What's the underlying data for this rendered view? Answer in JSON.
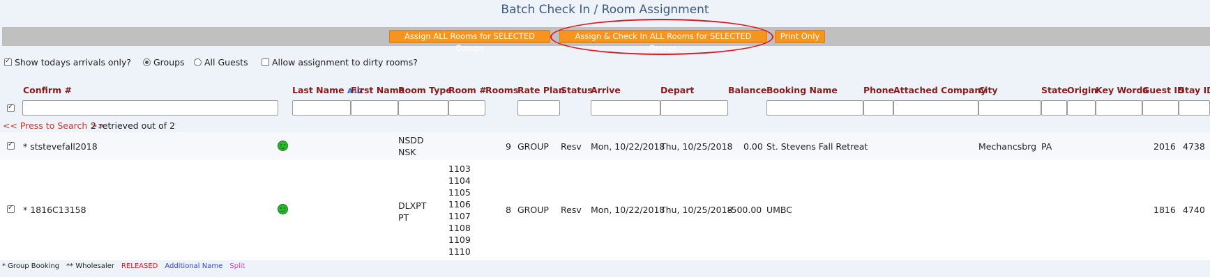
{
  "title": "Batch Check In / Room Assignment",
  "toolbar": {
    "assign_all": "Assign ALL Rooms for SELECTED Groups",
    "assign_checkin": "Assign & Check In ALL Rooms for SELECTED Groups",
    "print_only": "Print Only"
  },
  "options": {
    "todays_arrivals": "Show todays arrivals only?",
    "groups": "Groups",
    "all_guests": "All Guests",
    "dirty_rooms": "Allow assignment to dirty rooms?"
  },
  "columns": {
    "confirm": "Confirm #",
    "last_name": "Last Name",
    "first_name": "First Name",
    "room_type": "Room Type",
    "room_no": "Room #",
    "rooms": "Rooms",
    "rate_plan": "Rate Plan",
    "status": "Status",
    "arrive": "Arrive",
    "depart": "Depart",
    "balance": "Balance",
    "booking_name": "Booking Name",
    "phone": "Phone",
    "attached_company": "Attached Company",
    "city": "City",
    "state": "State",
    "origin": "Origin",
    "key_words": "Key Words",
    "guest_id": "Guest ID",
    "stay_id": "Stay ID"
  },
  "search": {
    "press": "<< Press to Search >>",
    "retrieved": "2 retrieved out of 2"
  },
  "rows": [
    {
      "confirm": "* ststevefall2018",
      "room_type": [
        "NSDD",
        "NSK"
      ],
      "rooms": "9",
      "rate_plan": "GROUP",
      "status": "Resv",
      "arrive": "Mon, 10/22/2018",
      "depart": "Thu, 10/25/2018",
      "balance": "0.00",
      "booking_name": "St. Stevens Fall Retreat",
      "city": "Mechancsbrg",
      "state": "PA",
      "guest_id": "2016",
      "stay_id": "4738"
    },
    {
      "confirm": "* 1816C13158",
      "room_type": [
        "DLXPT",
        "PT"
      ],
      "room_numbers": [
        "1103",
        "1104",
        "1105",
        "1106",
        "1107",
        "1108",
        "1109",
        "1110"
      ],
      "rooms": "8",
      "rate_plan": "GROUP",
      "status": "Resv",
      "arrive": "Mon, 10/22/2018",
      "depart": "Thu, 10/25/2018",
      "balance": "-500.00",
      "booking_name": "UMBC",
      "guest_id": "1816",
      "stay_id": "4740"
    }
  ],
  "legend": {
    "group_booking": "* Group Booking",
    "wholesaler": "** Wholesaler",
    "released": "RELEASED",
    "additional_name": "Additional Name",
    "split": "Split"
  },
  "colors": {
    "button": "#f7941d",
    "header_text": "#8b1a1a",
    "highlight": "#e3161f",
    "title": "#3d5a80"
  }
}
